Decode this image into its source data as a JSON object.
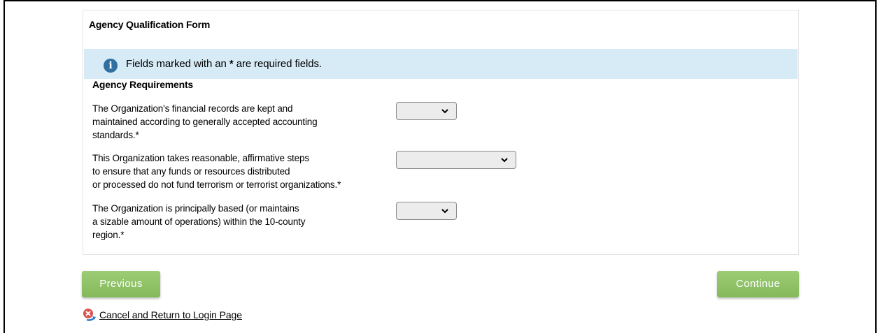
{
  "form": {
    "title": "Agency Qualification Form",
    "info": {
      "icon": "info-icon",
      "text_before": "Fields marked with an",
      "asterisk": "*",
      "text_after": "are required fields."
    },
    "section_title": "Agency Requirements",
    "questions": [
      {
        "lines": [
          "The Organization's financial records are kept and",
          "maintained according to generally accepted accounting",
          "standards.*"
        ],
        "selected_value": ""
      },
      {
        "lines": [
          "This Organization takes reasonable, affirmative steps",
          "to ensure that any funds or resources distributed",
          "or processed do not fund terrorism or terrorist organizations.*"
        ],
        "selected_value": ""
      },
      {
        "lines": [
          "The Organization is principally based (or maintains",
          "a sizable amount of operations) within the 10-county",
          "region.*"
        ],
        "selected_value": ""
      }
    ]
  },
  "actions": {
    "previous_label": "Previous",
    "continue_label": "Continue",
    "cancel_label": "Cancel and Return to Login Page",
    "button_color": "#8cc063"
  }
}
